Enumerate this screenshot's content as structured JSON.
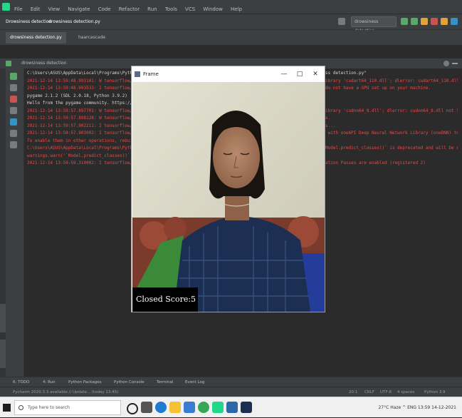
{
  "ide": {
    "menu": [
      "File",
      "Edit",
      "View",
      "Navigate",
      "Code",
      "Refactor",
      "Run",
      "Tools",
      "VCS",
      "Window",
      "Help"
    ],
    "breadcrumbs": [
      "Drowsiness detection",
      "drowsiness detection.py"
    ],
    "run_config": "drowsiness detection",
    "tabs": [
      "drowsiness detection.py",
      "haarcascade"
    ],
    "run_tab": "drowsiness detection"
  },
  "console_lines": [
    {
      "text": "C:\\Users\\ASUS\\AppData\\Local\\Programs\\Python\\Python39\\python.exe \"C:/Users/ASUS/Desktop/Drowsiness detection/drowsiness detection.py\"",
      "color": "white"
    },
    {
      "text": "2021-12-14 13:59:48.993101: W tensorflow/stream_executor/platform/default/dso_loader.cc:64] Could not load dynamic library 'cudart64_110.dll'; dlerror: cudart64_110.dll not found",
      "color": "red"
    },
    {
      "text": "2021-12-14 13:59:48.993533: I tensorflow/stream_executor/cuda/cudart_stub.cc:29] Ignore above cudart dlerror if you do not have a GPU set up on your machine.",
      "color": "red"
    },
    {
      "text": "pygame 2.1.2 (SDL 2.0.18, Python 3.9.2)",
      "color": "white"
    },
    {
      "text": "Hello from the pygame community. https://www.pygame.org/contribute.html",
      "color": "white"
    },
    {
      "text": "2021-12-14 13:59:57.897701: W tensorflow/stream_executor/platform/default/dso_loader.cc:64] Could not load dynamic library 'cudnn64_8.dll'; dlerror: cudnn64_8.dll not found",
      "color": "red"
    },
    {
      "text": "2021-12-14 13:59:57.898128: W tensorflow/core/common_runtime/gpu/gpu_device.cc:1835] Cannot dlopen some GPU libraries.",
      "color": "red"
    },
    {
      "text": "2021-12-14 13:59:57.902211: I tensorflow/core/common_runtime/gpu/gpu_device.cc:1850] Skipping registering GPU devices...",
      "color": "red"
    },
    {
      "text": "2021-12-14 13:59:57.903002: I tensorflow/core/platform/cpu_feature_guard.cc:151] This TensorFlow binary is optimized with oneAPI Deep Neural Network Library (oneDNN) to use the following CPU",
      "color": "red"
    },
    {
      "text": "To enable them in other operations, rebuild TensorFlow with the appropriate compiler flags.",
      "color": "red"
    },
    {
      "text": "C:\\Users\\ASUS\\AppData\\Local\\Programs\\Python\\Python39\\lib\\site-packages\\keras\\engine\\training.py:2470: UserWarning: `Model.predict_classes()` is deprecated and will be removed after",
      "color": "red"
    },
    {
      "text": "  warnings.warn('`Model.predict_classes()` is deprecated and '",
      "color": "red"
    },
    {
      "text": "2021-12-14 13:59:59.310002: I tensorflow/compiler/mlir/mlir_graph_optimization_pass.cc:185] None of the MLIR Optimization Passes are enabled (registered 2)",
      "color": "red"
    }
  ],
  "popup": {
    "title": "Frame",
    "controls": [
      "—",
      "□",
      "✕"
    ],
    "overlay_text": "Closed   Score:5"
  },
  "bottom_tools": [
    "6: TODO",
    "4: Run",
    "Python Packages",
    "Python Console",
    "Terminal",
    "Event Log"
  ],
  "status_text": "Pycharm 2020.3.3 available // Update... (today 13:45)",
  "status_right": [
    "20:1",
    "CRLF",
    "UTF-8",
    "4 spaces",
    "Python 3.9"
  ],
  "taskbar": {
    "search_placeholder": "Type here to search",
    "tray_text": "27°C Haze  ^  ENG  13:59  14-12-2021"
  },
  "colors": {
    "ide_bg": "#2b2b2b",
    "panel": "#3c3f41",
    "error_text": "#e84a4a",
    "link_text": "#5a9bd4",
    "taskbar": "#f0f0f0"
  }
}
